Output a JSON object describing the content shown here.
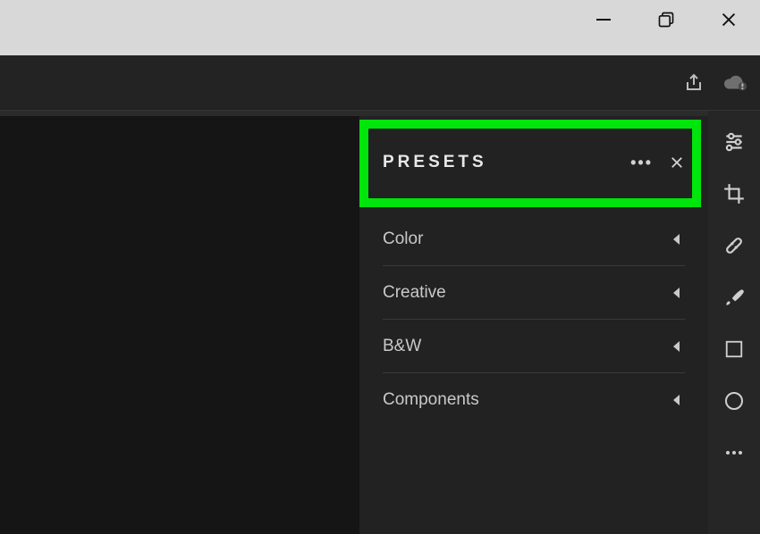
{
  "window": {
    "minimize": "minimize",
    "maximize": "maximize",
    "close": "close"
  },
  "toolbar": {
    "share": "share",
    "cloud": "cloud-sync"
  },
  "panel": {
    "title": "PRESETS",
    "more": "•••",
    "items": [
      {
        "label": "Color"
      },
      {
        "label": "Creative"
      },
      {
        "label": "B&W"
      },
      {
        "label": "Components"
      }
    ]
  },
  "rail": {
    "sliders": "edit-sliders",
    "crop": "crop",
    "heal": "healing",
    "brush": "brush",
    "square": "linear-gradient",
    "circle": "radial-gradient",
    "more": "more"
  }
}
